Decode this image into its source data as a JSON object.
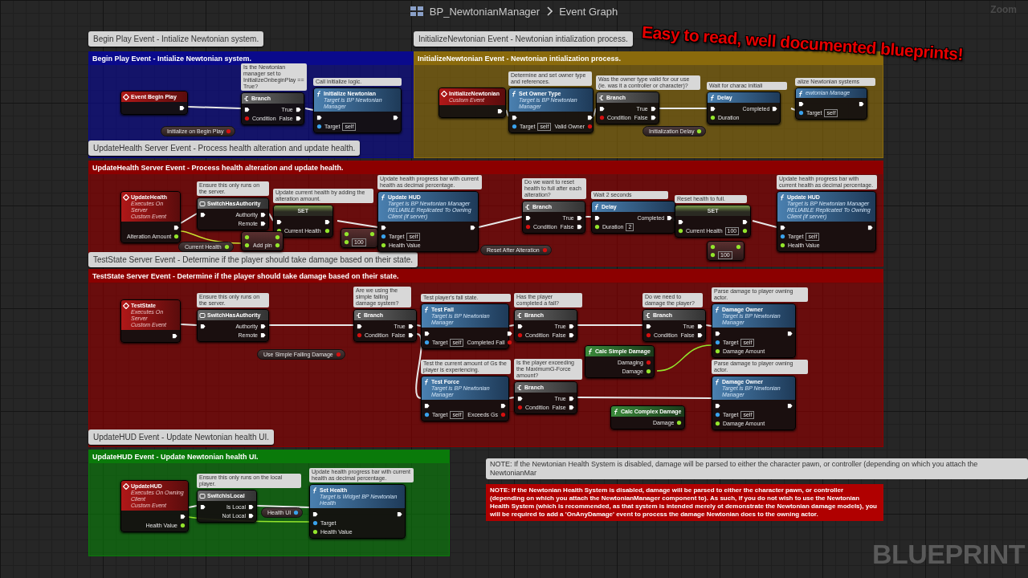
{
  "breadcrumb": {
    "asset": "BP_NewtonianManager",
    "graph": "Event Graph"
  },
  "zoom_label": "Zoom",
  "groups": [
    {
      "bubble": "Begin Play Event - Intialize Newtonian system.",
      "title": "Begin Play Event - Intialize Newtonian system.",
      "color": "#0a0a8c",
      "nodes": [
        {
          "kind": "event",
          "title": "Event Begin Play",
          "outputs": [
            {
              "kind": "exec"
            }
          ]
        },
        {
          "kind": "variable",
          "title": "Initialize on Begin Play",
          "outputs": [
            {
              "kind": "bool"
            }
          ]
        },
        {
          "kind": "branch",
          "title": "Branch",
          "comment": "Is the Newtonian manager set to InitializeOnbeginPlay == True?",
          "inputs": [
            {
              "kind": "exec"
            },
            {
              "kind": "bool",
              "label": "Condition"
            }
          ],
          "outputs": [
            {
              "kind": "exec",
              "label": "True"
            },
            {
              "kind": "exec",
              "label": "False"
            }
          ]
        },
        {
          "kind": "function",
          "title": "Initialize Newtonian",
          "subtitle": [
            "Target is BP Newtonian Manager"
          ],
          "comment": "Call initialize logic.",
          "inputs": [
            {
              "kind": "exec"
            },
            {
              "kind": "object",
              "label": "Target",
              "default": "self"
            }
          ],
          "outputs": [
            {
              "kind": "exec"
            }
          ]
        }
      ]
    },
    {
      "bubble": "InitializeNewtonian Event - Newtonian intialization process.",
      "title": "InitializeNewtonian Event - Newtonian intialization process.",
      "color": "#8a6a0c",
      "nodes": [
        {
          "kind": "event",
          "title": "InitializeNewtonian",
          "subtitle": [
            "Custom Event"
          ],
          "outputs": [
            {
              "kind": "exec"
            }
          ]
        },
        {
          "kind": "function",
          "title": "Set Owner Type",
          "subtitle": [
            "Target is BP Newtonian Manager"
          ],
          "comment": "Determine and set owner type and references.",
          "inputs": [
            {
              "kind": "exec"
            },
            {
              "kind": "object",
              "label": "Target",
              "default": "self"
            }
          ],
          "outputs": [
            {
              "kind": "exec"
            },
            {
              "kind": "bool",
              "label": "Valid Owner"
            }
          ]
        },
        {
          "kind": "branch",
          "title": "Branch",
          "comment": "Was the owner type valid for our use (ie. was it a controller or character)?",
          "inputs": [
            {
              "kind": "exec"
            },
            {
              "kind": "bool",
              "label": "Condition"
            }
          ],
          "outputs": [
            {
              "kind": "exec",
              "label": "True"
            },
            {
              "kind": "exec",
              "label": "False"
            }
          ]
        },
        {
          "kind": "variable",
          "title": "Initialization Delay",
          "outputs": [
            {
              "kind": "float"
            }
          ]
        },
        {
          "kind": "function",
          "title": "Delay",
          "comment": "Wait for charac initiali",
          "inputs": [
            {
              "kind": "exec"
            },
            {
              "kind": "float",
              "label": "Duration"
            }
          ],
          "outputs": [
            {
              "kind": "exec",
              "label": "Completed"
            }
          ]
        },
        {
          "kind": "function",
          "subtitle": [
            "ewtonian Manage"
          ],
          "comment": "alize Newtonian systems",
          "inputs": [
            {
              "kind": "exec"
            },
            {
              "kind": "object",
              "label": "Target",
              "default": "self"
            }
          ],
          "outputs": [
            {
              "kind": "exec"
            }
          ]
        }
      ]
    },
    {
      "bubble": "UpdateHealth Server Event - Process health alteration and update health.",
      "title": "UpdateHealth Server Event - Process health alteration and update health.",
      "color": "#8c0000",
      "nodes": [
        {
          "kind": "event",
          "title": "UpdateHealth",
          "subtitle": [
            "Executes On Server",
            "Custom Event"
          ],
          "outputs": [
            {
              "kind": "exec"
            },
            {
              "kind": "float",
              "label": "Alteration Amount"
            }
          ]
        },
        {
          "kind": "macro",
          "title": "SwitchHasAuthority",
          "comment": "Ensure this only runs on the server.",
          "inputs": [
            {
              "kind": "exec"
            }
          ],
          "outputs": [
            {
              "kind": "exec",
              "label": "Authority"
            },
            {
              "kind": "exec",
              "label": "Remote"
            }
          ]
        },
        {
          "kind": "set",
          "title": "SET",
          "comment": "Update current health by adding the alteration amount.",
          "inputs": [
            {
              "kind": "exec"
            },
            {
              "kind": "float",
              "label": "Current Health"
            }
          ],
          "outputs": [
            {
              "kind": "exec"
            },
            {
              "kind": "float"
            }
          ]
        },
        {
          "kind": "variable",
          "title": "Current Health",
          "outputs": [
            {
              "kind": "float"
            }
          ]
        },
        {
          "kind": "math",
          "inputs": [
            {
              "kind": "float"
            },
            {
              "kind": "float"
            }
          ],
          "outputs": [
            {
              "kind": "float"
            },
            {
              "kind": "float",
              "label": "Add pin"
            }
          ]
        },
        {
          "kind": "math",
          "inputs": [
            {
              "kind": "float"
            },
            {
              "kind": "float",
              "default": "100"
            }
          ],
          "outputs": [
            {
              "kind": "float"
            }
          ]
        },
        {
          "kind": "function",
          "title": "Update HUD",
          "subtitle": [
            "Target is BP Newtonian Manager",
            "RELIABLE Replicated To Owning Client (if server)"
          ],
          "comment": "Update health progress bar with current health as decimal percentage.",
          "inputs": [
            {
              "kind": "exec"
            },
            {
              "kind": "object",
              "label": "Target",
              "default": "self"
            },
            {
              "kind": "float",
              "label": "Health Value"
            }
          ],
          "outputs": [
            {
              "kind": "exec"
            }
          ]
        },
        {
          "kind": "variable",
          "title": "Reset After Alteration",
          "outputs": [
            {
              "kind": "bool"
            }
          ]
        },
        {
          "kind": "branch",
          "title": "Branch",
          "comment": "Do we want to reset health to full after each alteration?",
          "inputs": [
            {
              "kind": "exec"
            },
            {
              "kind": "bool",
              "label": "Condition"
            }
          ],
          "outputs": [
            {
              "kind": "exec",
              "label": "True"
            },
            {
              "kind": "exec",
              "label": "False"
            }
          ]
        },
        {
          "kind": "function",
          "title": "Delay",
          "comment": "Wait 2 seconds",
          "inputs": [
            {
              "kind": "exec"
            },
            {
              "kind": "float",
              "label": "Duration",
              "default": "2"
            }
          ],
          "outputs": [
            {
              "kind": "exec",
              "label": "Completed"
            }
          ]
        },
        {
          "kind": "set",
          "title": "SET",
          "comment": "Reset health to full.",
          "inputs": [
            {
              "kind": "exec"
            },
            {
              "kind": "float",
              "label": "Current Health",
              "default": "100"
            }
          ],
          "outputs": [
            {
              "kind": "exec"
            },
            {
              "kind": "float"
            }
          ]
        },
        {
          "kind": "math",
          "inputs": [
            {
              "kind": "float"
            },
            {
              "kind": "float",
              "default": "100"
            }
          ],
          "outputs": [
            {
              "kind": "float"
            }
          ]
        },
        {
          "kind": "function",
          "title": "Update HUD",
          "subtitle": [
            "Target is BP Newtonian Manager",
            "RELIABLE Replicated To Owning Client (if server)"
          ],
          "comment": "Update health progress bar with current health as decimal percentage.",
          "inputs": [
            {
              "kind": "exec"
            },
            {
              "kind": "object",
              "label": "Target",
              "default": "self"
            },
            {
              "kind": "float",
              "label": "Health Value"
            }
          ],
          "outputs": [
            {
              "kind": "exec"
            }
          ]
        }
      ]
    },
    {
      "bubble": "TestState Server Event - Determine if the player should take damage based on their state.",
      "title": "TestState Server Event - Determine if the player should take damage based on their state.",
      "color": "#8c0000",
      "nodes": [
        {
          "kind": "event",
          "title": "TestState",
          "subtitle": [
            "Executes On Server",
            "Custom Event"
          ],
          "outputs": [
            {
              "kind": "exec"
            }
          ]
        },
        {
          "kind": "macro",
          "title": "SwitchHasAuthority",
          "comment": "Ensure this only runs on the server.",
          "inputs": [
            {
              "kind": "exec"
            }
          ],
          "outputs": [
            {
              "kind": "exec",
              "label": "Authority"
            },
            {
              "kind": "exec",
              "label": "Remote"
            }
          ]
        },
        {
          "kind": "variable",
          "title": "Use Simple Falling Damage",
          "outputs": [
            {
              "kind": "bool"
            }
          ]
        },
        {
          "kind": "branch",
          "title": "Branch",
          "comment": "Are we using the simple falling damage system?",
          "inputs": [
            {
              "kind": "exec"
            },
            {
              "kind": "bool",
              "label": "Condition"
            }
          ],
          "outputs": [
            {
              "kind": "exec",
              "label": "True"
            },
            {
              "kind": "exec",
              "label": "False"
            }
          ]
        },
        {
          "kind": "function",
          "title": "Test Fall",
          "subtitle": [
            "Target is BP Newtonian Manager"
          ],
          "comment": "Test player's fall state.",
          "inputs": [
            {
              "kind": "exec"
            },
            {
              "kind": "object",
              "label": "Target",
              "default": "self"
            }
          ],
          "outputs": [
            {
              "kind": "exec"
            },
            {
              "kind": "bool",
              "label": "Completed Fall"
            }
          ]
        },
        {
          "kind": "branch",
          "title": "Branch",
          "comment": "Has the player completed a fall?",
          "inputs": [
            {
              "kind": "exec"
            },
            {
              "kind": "bool",
              "label": "Condition"
            }
          ],
          "outputs": [
            {
              "kind": "exec",
              "label": "True"
            },
            {
              "kind": "exec",
              "label": "False"
            }
          ]
        },
        {
          "kind": "pure",
          "title": "Calc Simple Damage",
          "outputs": [
            {
              "kind": "bool",
              "label": "Damaging"
            },
            {
              "kind": "float",
              "label": "Damage"
            }
          ]
        },
        {
          "kind": "branch",
          "title": "Branch",
          "comment": "Do we need to damage the player?",
          "inputs": [
            {
              "kind": "exec"
            },
            {
              "kind": "bool",
              "label": "Condition"
            }
          ],
          "outputs": [
            {
              "kind": "exec",
              "label": "True"
            },
            {
              "kind": "exec",
              "label": "False"
            }
          ]
        },
        {
          "kind": "function",
          "title": "Damage Owner",
          "subtitle": [
            "Target is BP Newtonian Manager"
          ],
          "comment": "Parse damage to player owning actor.",
          "inputs": [
            {
              "kind": "exec"
            },
            {
              "kind": "object",
              "label": "Target",
              "default": "self"
            },
            {
              "kind": "float",
              "label": "Damage Amount"
            }
          ],
          "outputs": [
            {
              "kind": "exec"
            }
          ]
        },
        {
          "kind": "function",
          "title": "Test Force",
          "subtitle": [
            "Target is BP Newtonian Manager"
          ],
          "comment": "Test the current amount of Gs the player is experiencing.",
          "inputs": [
            {
              "kind": "exec"
            },
            {
              "kind": "object",
              "label": "Target",
              "default": "self"
            }
          ],
          "outputs": [
            {
              "kind": "exec"
            },
            {
              "kind": "bool",
              "label": "Exceeds Gs"
            }
          ]
        },
        {
          "kind": "branch",
          "title": "Branch",
          "comment": "Is the player exceeding the MaximumG-Force amount?",
          "inputs": [
            {
              "kind": "exec"
            },
            {
              "kind": "bool",
              "label": "Condition"
            }
          ],
          "outputs": [
            {
              "kind": "exec",
              "label": "True"
            },
            {
              "kind": "exec",
              "label": "False"
            }
          ]
        },
        {
          "kind": "pure",
          "title": "Calc Complex Damage",
          "outputs": [
            {
              "kind": "float",
              "label": "Damage"
            }
          ]
        },
        {
          "kind": "function",
          "title": "Damage Owner",
          "subtitle": [
            "Target is BP Newtonian Manager"
          ],
          "comment": "Parse damage to player owning actor.",
          "inputs": [
            {
              "kind": "exec"
            },
            {
              "kind": "object",
              "label": "Target",
              "default": "self"
            },
            {
              "kind": "float",
              "label": "Damage Amount"
            }
          ],
          "outputs": [
            {
              "kind": "exec"
            }
          ]
        }
      ]
    },
    {
      "bubble": "UpdateHUD Event - Update Newtonian health UI.",
      "title": "UpdateHUD Event - Update Newtonian health UI.",
      "color": "#0a7a0a",
      "nodes": [
        {
          "kind": "event",
          "title": "UpdateHUD",
          "subtitle": [
            "Executes On Owning Client",
            "Custom Event"
          ],
          "outputs": [
            {
              "kind": "exec"
            },
            {
              "kind": "float",
              "label": "Health Value"
            }
          ]
        },
        {
          "kind": "macro",
          "title": "SwitchIsLocal",
          "comment": "Ensure this only runs on the local player.",
          "inputs": [
            {
              "kind": "exec"
            }
          ],
          "outputs": [
            {
              "kind": "exec",
              "label": "Is Local"
            },
            {
              "kind": "exec",
              "label": "Not Local"
            }
          ]
        },
        {
          "kind": "variable",
          "title": "Health UI",
          "outputs": [
            {
              "kind": "object"
            }
          ]
        },
        {
          "kind": "function",
          "title": "Set Health",
          "subtitle": [
            "Target is Widget BP Newtonian Health"
          ],
          "comment": "Update health progress bar with current health as decimal percentage.",
          "inputs": [
            {
              "kind": "exec"
            },
            {
              "kind": "object",
              "label": "Target"
            },
            {
              "kind": "float",
              "label": "Health Value"
            }
          ],
          "outputs": [
            {
              "kind": "exec"
            }
          ]
        }
      ]
    }
  ],
  "note": {
    "bubble": "NOTE: If the Newtonian Health System is disabled, damage will be parsed to either the character pawn, or controller (depending on which you attach the NewtonianMar",
    "text": "NOTE: If the Newtonian Health System is disabled, damage will be parsed to either the character pawn, or controller (depending on which you attach the NewtonianManager component to). As such, if you do not wish to use the Newtonian Health System (which is recommended, as that system is intended merely ot demonstrate the Newtonian damage models), you will be required to add a 'OnAnyDamage' event to process the damage Newtonian does to the owning actor."
  },
  "promo_text": "Easy to read, well documented blueprints!",
  "watermark": "BLUEPRINT"
}
